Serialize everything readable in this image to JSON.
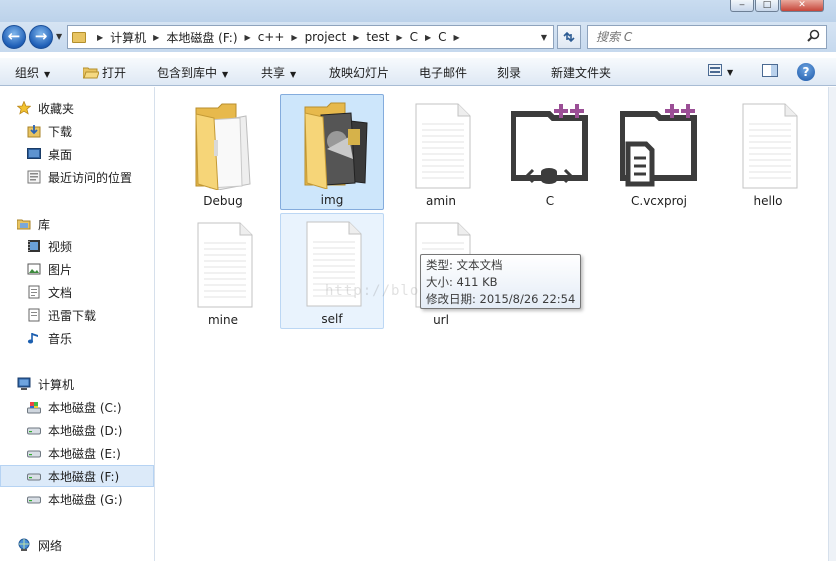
{
  "address": {
    "crumbs": [
      "计算机",
      "本地磁盘 (F:)",
      "c++",
      "project",
      "test",
      "C",
      "C"
    ]
  },
  "search": {
    "placeholder": "搜索 C"
  },
  "toolbar": {
    "organize": "组织",
    "open": "打开",
    "include_in_library": "包含到库中",
    "share": "共享",
    "slideshow": "放映幻灯片",
    "email": "电子邮件",
    "burn": "刻录",
    "new_folder": "新建文件夹"
  },
  "sidebar": {
    "favorites": "收藏夹",
    "downloads": "下载",
    "desktop": "桌面",
    "recent": "最近访问的位置",
    "libraries": "库",
    "videos": "视频",
    "pictures": "图片",
    "documents": "文档",
    "xunlei": "迅雷下载",
    "music": "音乐",
    "computer": "计算机",
    "drive_c": "本地磁盘 (C:)",
    "drive_d": "本地磁盘 (D:)",
    "drive_e": "本地磁盘 (E:)",
    "drive_f": "本地磁盘 (F:)",
    "drive_g": "本地磁盘 (G:)",
    "network": "网络"
  },
  "files": {
    "debug": "Debug",
    "img": "img",
    "amin": "amin",
    "c": "C",
    "vcxproj": "C.vcxproj",
    "hello": "hello",
    "mine": "mine",
    "self": "self",
    "url": "url"
  },
  "tooltip": {
    "type": "类型: 文本文档",
    "size": "大小: 411 KB",
    "modified": "修改日期: 2015/8/26 22:54"
  },
  "watermark": "http://blog.csdn.net/",
  "colors": {
    "selection": "#cde6fb",
    "vs_purple": "#9b4f96",
    "folder_yellow": "#f3cf6b"
  }
}
